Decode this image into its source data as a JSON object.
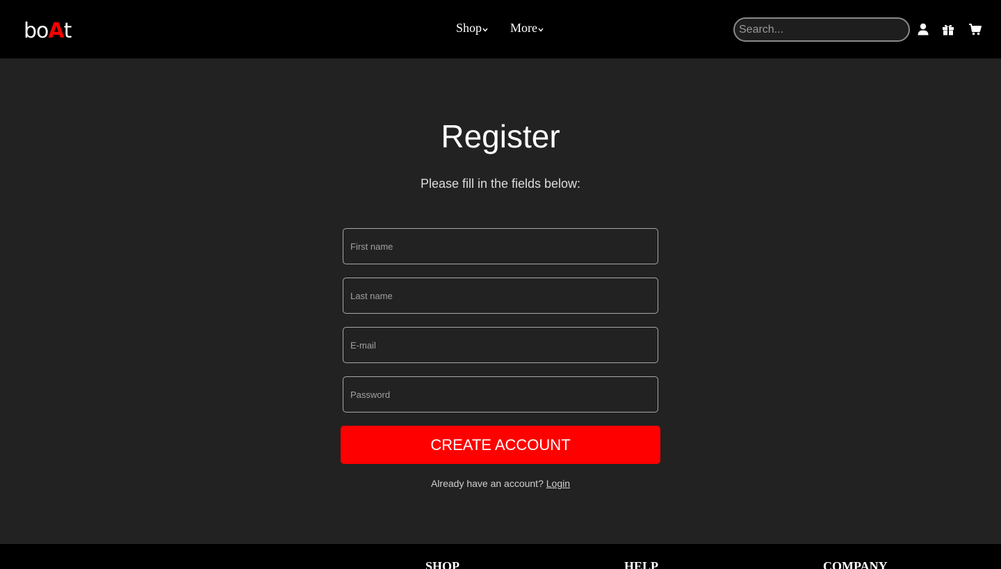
{
  "brand": {
    "logo_parts": [
      "bo",
      "A",
      "t"
    ],
    "accent_color": "#ff0000"
  },
  "nav": {
    "items": [
      {
        "label": "Shop",
        "icon": "chevron-down-icon"
      },
      {
        "label": "More",
        "icon": "chevron-down-icon"
      }
    ]
  },
  "search": {
    "placeholder": "Search..."
  },
  "header_icons": [
    "user-icon",
    "gift-icon",
    "cart-icon"
  ],
  "register": {
    "title": "Register",
    "subtitle": "Please fill in the fields below:",
    "fields": [
      {
        "placeholder": "First name"
      },
      {
        "placeholder": "Last name"
      },
      {
        "placeholder": "E-mail"
      },
      {
        "placeholder": "Password"
      }
    ],
    "submit_label": "CREATE ACCOUNT",
    "login_prompt": "Already have an account?",
    "login_link": "Login"
  },
  "footer": {
    "headings": [
      "SHOP",
      "HELP",
      "COMPANY"
    ]
  },
  "colors": {
    "header_bg": "#000000",
    "page_bg": "#222222",
    "button_bg": "#ff0000"
  }
}
